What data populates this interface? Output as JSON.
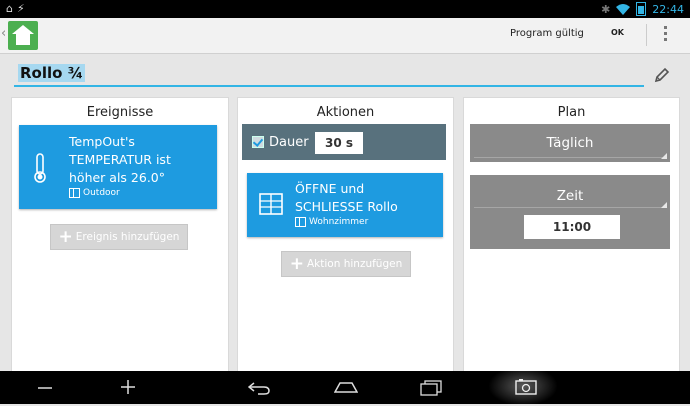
{
  "statusbar": {
    "time": "22:44",
    "left_icons": [
      "android-notification-icon",
      "flash-icon"
    ],
    "right_icons": [
      "bluetooth-icon",
      "wifi-icon",
      "battery-icon"
    ]
  },
  "actionbar": {
    "program_status": "Program gültig",
    "ok_label": "OK"
  },
  "rule": {
    "name": "Rollo ¾"
  },
  "panels": {
    "events": {
      "title": "Ereignisse",
      "card": {
        "line1": "TempOut's",
        "line2": "TEMPERATUR ist",
        "line3": "höher als 26.0°",
        "room": "Outdoor"
      },
      "add_label": "Ereignis hinzufügen"
    },
    "actions": {
      "title": "Aktionen",
      "duration_label": "Dauer",
      "duration_value": "30 s",
      "card": {
        "line1": "ÖFFNE und",
        "line2": "SCHLIESSE Rollo",
        "room": "Wohnzimmer"
      },
      "add_label": "Aktion hinzufügen"
    },
    "plan": {
      "title": "Plan",
      "frequency": "Täglich",
      "time_label": "Zeit",
      "time_value": "11:00"
    }
  },
  "colors": {
    "accent": "#1e9be0",
    "home_green": "#4caf50",
    "dark_bar": "#58717d",
    "grey_box": "#8a8a8a"
  }
}
